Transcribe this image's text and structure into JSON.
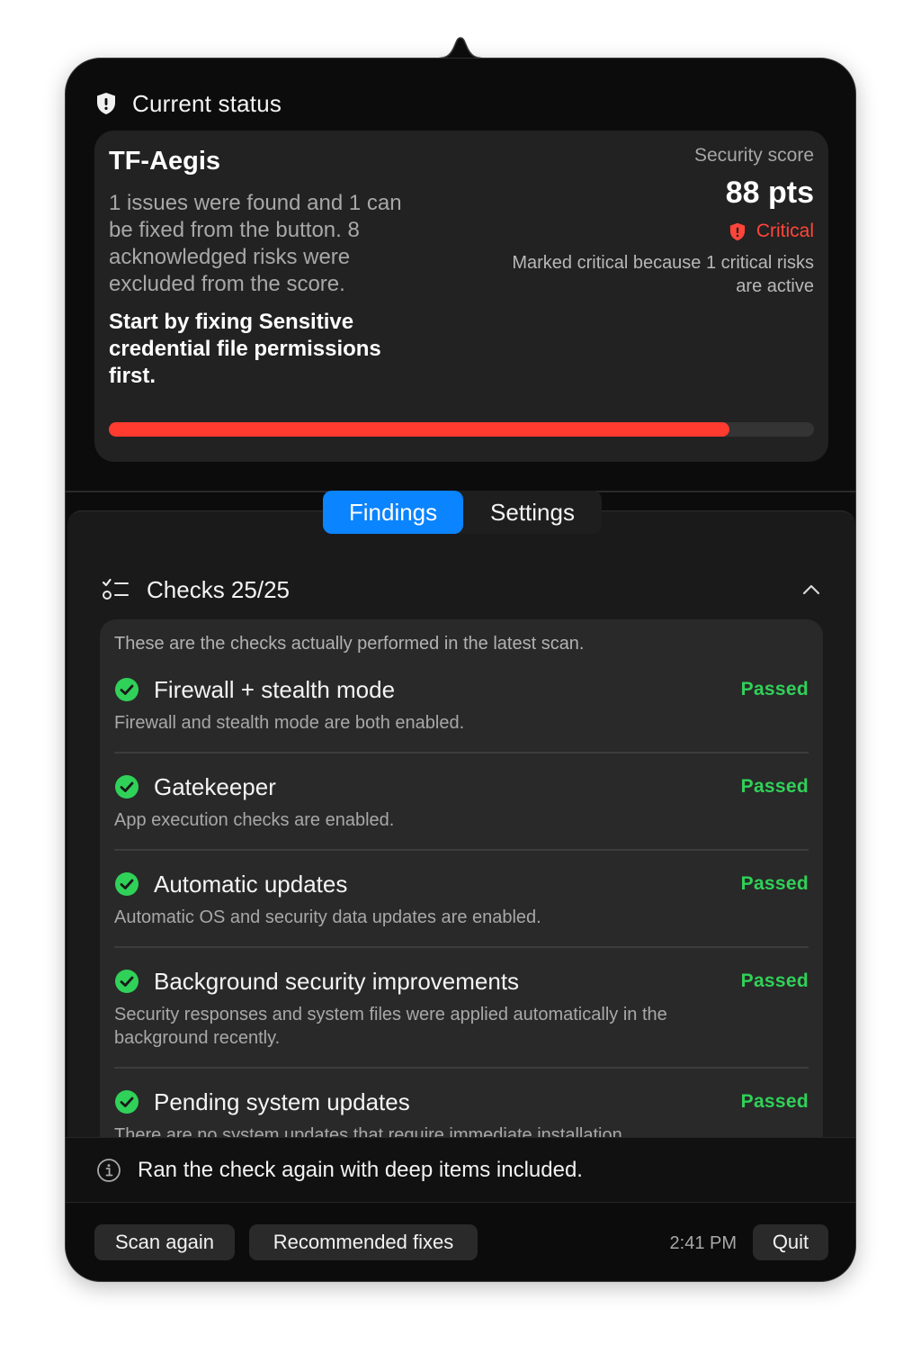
{
  "header": {
    "title": "Current status",
    "icon": "shield-icon"
  },
  "status_card": {
    "app_name": "TF-Aegis",
    "summary": "1 issues were found and 1 can be fixed from the button. 8 acknowledged risks were excluded from the score.",
    "advice": "Start by fixing Sensitive credential file permissions first.",
    "score_label": "Security score",
    "score_value": "88 pts",
    "severity": "Critical",
    "severity_reason": "Marked critical because 1 critical risks are active",
    "progress_fraction": 0.88,
    "colors": {
      "progress": "#ff3b30",
      "severity": "#ff453a"
    }
  },
  "tabs": [
    {
      "label": "Findings",
      "active": true
    },
    {
      "label": "Settings",
      "active": false
    }
  ],
  "checks": {
    "title": "Checks 25/25",
    "intro": "These are the checks actually performed in the latest scan.",
    "items": [
      {
        "name": "Firewall + stealth mode",
        "status": "Passed",
        "description": "Firewall and stealth mode are both enabled."
      },
      {
        "name": "Gatekeeper",
        "status": "Passed",
        "description": "App execution checks are enabled."
      },
      {
        "name": "Automatic updates",
        "status": "Passed",
        "description": "Automatic OS and security data updates are enabled."
      },
      {
        "name": "Background security improvements",
        "status": "Passed",
        "description": "Security responses and system files were applied automatically in the background recently."
      },
      {
        "name": "Pending system updates",
        "status": "Passed",
        "description": "There are no system updates that require immediate installation."
      }
    ],
    "status_color": "#30d158"
  },
  "footer": {
    "note": "Ran the check again with deep items included.",
    "scan_again": "Scan again",
    "recommended_fixes": "Recommended fixes",
    "time": "2:41 PM",
    "quit": "Quit"
  },
  "accent_color": "#0a84ff"
}
